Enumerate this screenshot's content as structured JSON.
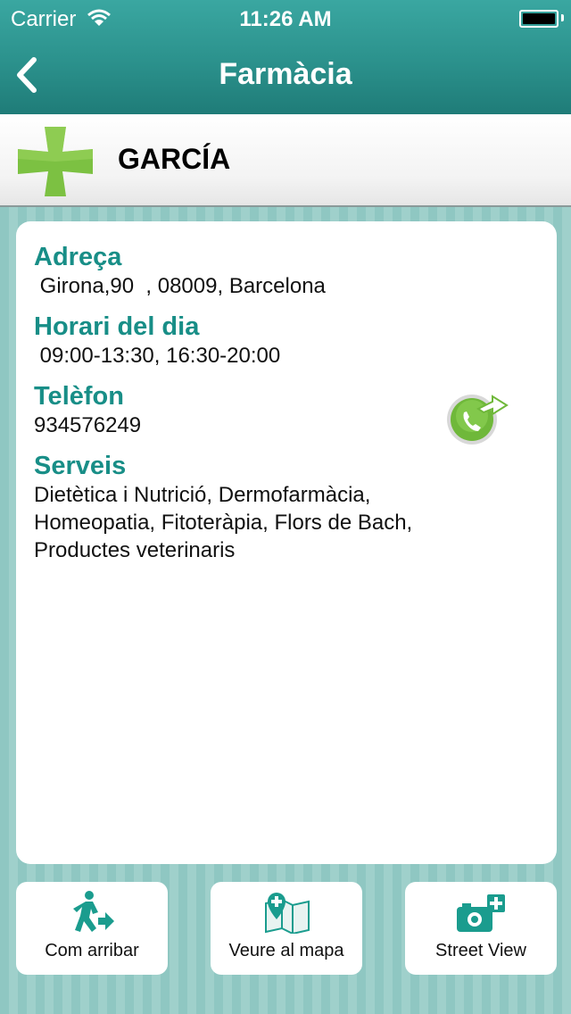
{
  "status": {
    "carrier": "Carrier",
    "time": "11:26 AM"
  },
  "nav": {
    "title": "Farmàcia"
  },
  "pharmacy": {
    "name": "GARCÍA"
  },
  "details": {
    "address_label": "Adreça",
    "address": " Girona,90  , 08009, Barcelona",
    "hours_label": "Horari del dia",
    "hours": " 09:00-13:30, 16:30-20:00",
    "phone_label": "Telèfon",
    "phone": "934576249",
    "services_label": "Serveis",
    "services_lines": [
      "Dietètica i Nutrició, Dermofarmàcia,",
      "Homeopatia, Fitoteràpia, Flors de Bach,",
      "Productes veterinaris"
    ]
  },
  "actions": {
    "directions": "Com arribar",
    "map": "Veure al mapa",
    "street_view": "Street View"
  },
  "colors": {
    "accent": "#188e87",
    "navbar": "#2b918c",
    "cross": "#7cc142"
  }
}
